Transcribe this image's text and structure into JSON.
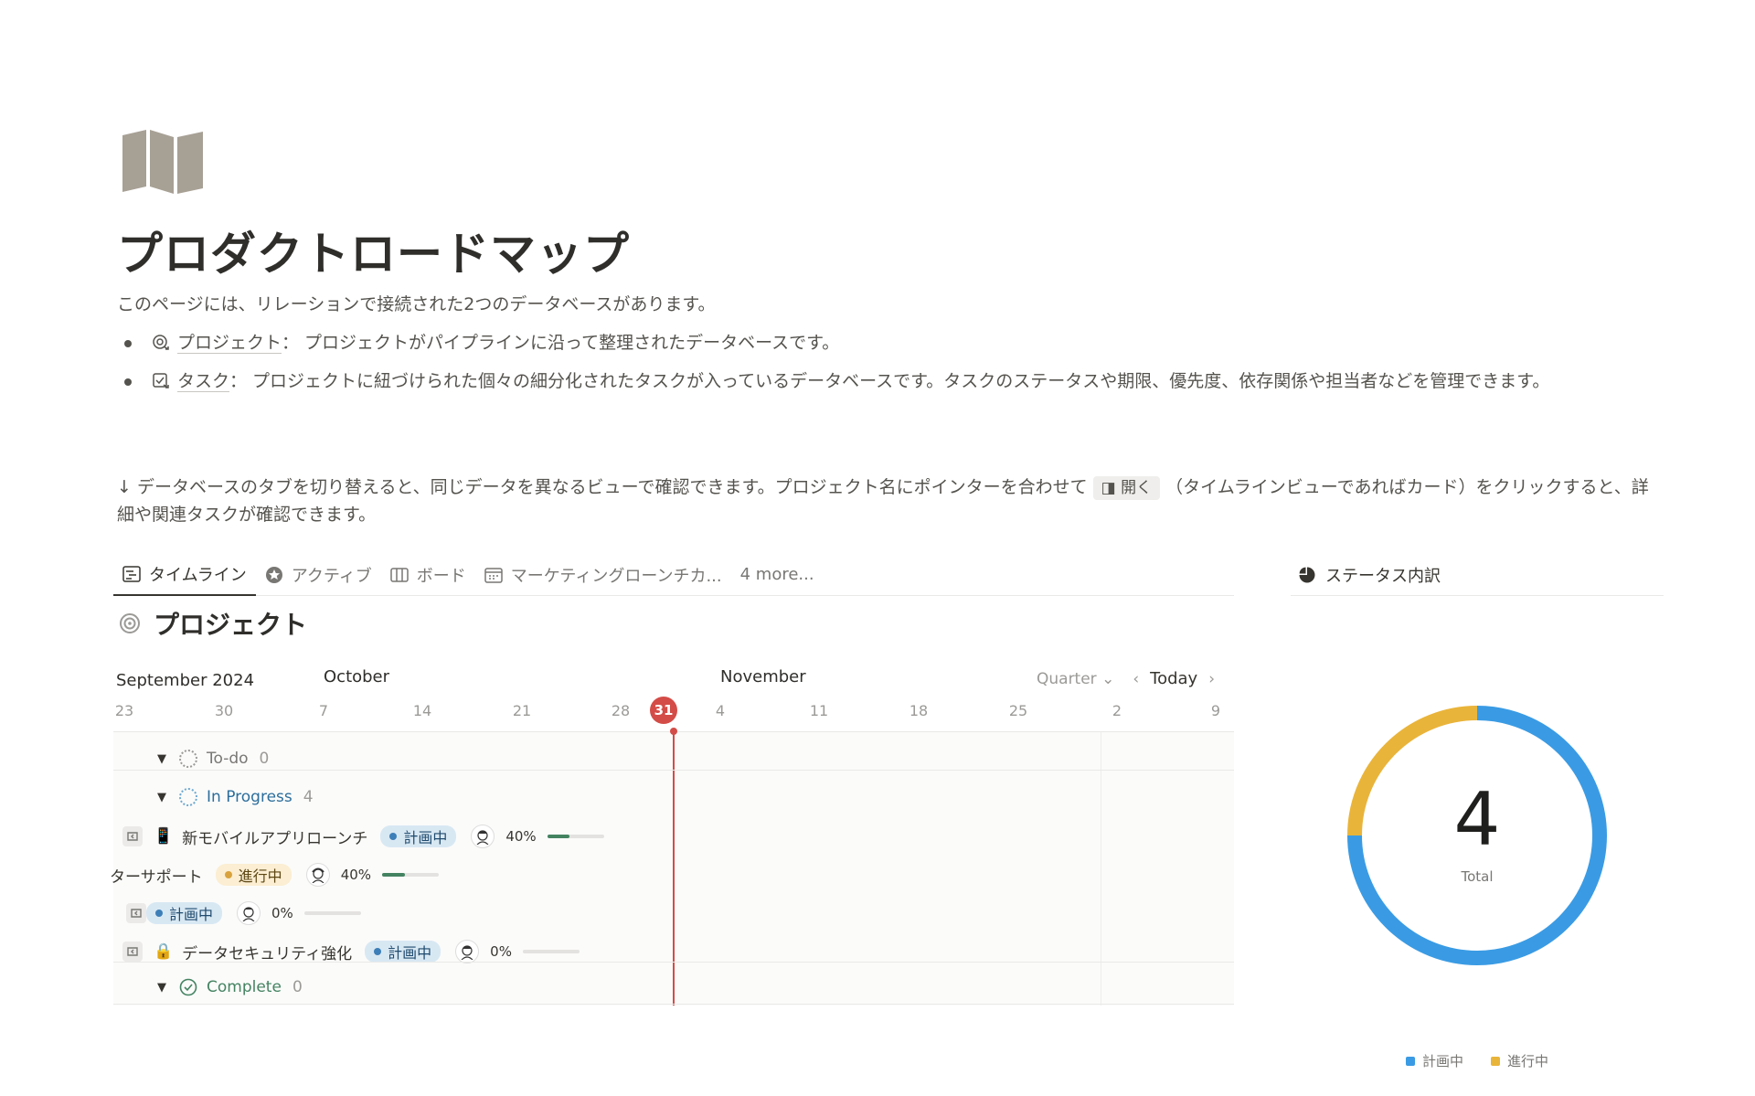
{
  "page": {
    "title": "プロダクトロードマップ",
    "intro": "このページには、リレーションで接続された2つのデータベースがあります。",
    "bullets": [
      {
        "link": "プロジェクト",
        "text": "： プロジェクトがパイプラインに沿って整理されたデータベースです。"
      },
      {
        "link": "タスク",
        "text": "： プロジェクトに紐づけられた個々の細分化されたタスクが入っているデータベースです。タスクのステータスや期限、優先度、依存関係や担当者などを管理できます。"
      }
    ],
    "hint_before": "↓ データベースのタブを切り替えると、同じデータを異なるビューで確認できます。プロジェクト名にポインターを合わせて",
    "hint_button": "◨ 開く",
    "hint_after": "（タイムラインビューであればカード）をクリックすると、詳細や関連タスクが確認できます。"
  },
  "tabs": [
    {
      "label": "タイムライン",
      "active": true
    },
    {
      "label": "アクティブ"
    },
    {
      "label": "ボード"
    },
    {
      "label": "マーケティングローンチカ..."
    }
  ],
  "tabs_more": "4 more...",
  "database": {
    "title": "プロジェクト"
  },
  "timeline": {
    "months": {
      "sep": "September 2024",
      "oct": "October",
      "nov": "November"
    },
    "days": [
      "23",
      "30",
      "7",
      "14",
      "21",
      "28",
      "31",
      "4",
      "11",
      "18",
      "25",
      "2",
      "9"
    ],
    "today_label": "31",
    "controls": {
      "range": "Quarter",
      "today": "Today"
    },
    "groups": {
      "todo": {
        "label": "To-do",
        "count": "0"
      },
      "progress": {
        "label": "In Progress",
        "count": "4"
      },
      "complete": {
        "label": "Complete",
        "count": "0"
      }
    },
    "items": [
      {
        "name": "新モバイルアプリローンチ",
        "status": "計画中",
        "pct": "40%",
        "progress": 0.4
      },
      {
        "name": "ターサポート",
        "status": "進行中",
        "pct": "40%",
        "progress": 0.4
      },
      {
        "name": "",
        "status": "計画中",
        "pct": "0%",
        "progress": 0
      },
      {
        "name": "データセキュリティ強化",
        "status": "計画中",
        "pct": "0%",
        "progress": 0
      }
    ]
  },
  "status_panel": {
    "title": "ステータス内訳",
    "total": "4",
    "total_label": "Total",
    "segments": [
      {
        "label": "計画中",
        "value": 3,
        "color": "#3a9be4"
      },
      {
        "label": "進行中",
        "value": 1,
        "color": "#e9b43a"
      }
    ]
  }
}
